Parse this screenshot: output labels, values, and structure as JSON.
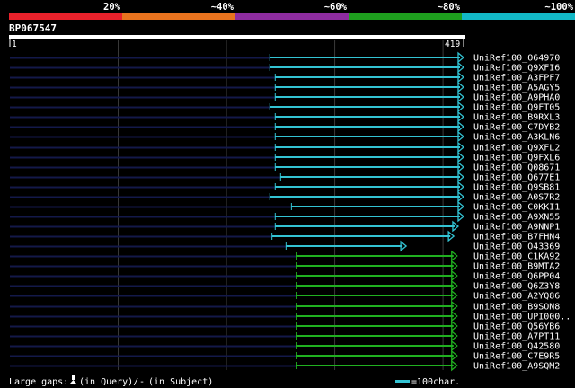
{
  "chart_data": {
    "type": "alignment_graphic",
    "query": {
      "name": "BP067547",
      "length": 419,
      "start_label": "1",
      "end_label": "419"
    },
    "identity_scale": [
      {
        "label": "20%",
        "color": "#e8212b"
      },
      {
        "label": "~40%",
        "color": "#e8731e"
      },
      {
        "label": "~60%",
        "color": "#8e2ca0"
      },
      {
        "label": "~80%",
        "color": "#1e9f1e"
      },
      {
        "label": "~100%",
        "color": "#12b8c6"
      }
    ],
    "hits": [
      {
        "name": "UniRef100_O64970",
        "q_start": 240,
        "q_end": 419,
        "color": "cyan",
        "arrow": "right"
      },
      {
        "name": "UniRef100_Q9XFI6",
        "q_start": 240,
        "q_end": 419,
        "color": "cyan",
        "arrow": "right"
      },
      {
        "name": "UniRef100_A3FPF7",
        "q_start": 245,
        "q_end": 419,
        "color": "cyan",
        "arrow": "right"
      },
      {
        "name": "UniRef100_A5AGY5",
        "q_start": 245,
        "q_end": 419,
        "color": "cyan",
        "arrow": "right"
      },
      {
        "name": "UniRef100_A9PHA0",
        "q_start": 245,
        "q_end": 419,
        "color": "cyan",
        "arrow": "right"
      },
      {
        "name": "UniRef100_Q9FT05",
        "q_start": 240,
        "q_end": 419,
        "color": "cyan",
        "arrow": "right"
      },
      {
        "name": "UniRef100_B9RXL3",
        "q_start": 245,
        "q_end": 419,
        "color": "cyan",
        "arrow": "right"
      },
      {
        "name": "UniRef100_C7DYB2",
        "q_start": 245,
        "q_end": 419,
        "color": "cyan",
        "arrow": "right"
      },
      {
        "name": "UniRef100_A3KLN6",
        "q_start": 245,
        "q_end": 419,
        "color": "cyan",
        "arrow": "right"
      },
      {
        "name": "UniRef100_Q9XFL2",
        "q_start": 245,
        "q_end": 419,
        "color": "cyan",
        "arrow": "right"
      },
      {
        "name": "UniRef100_Q9FXL6",
        "q_start": 245,
        "q_end": 419,
        "color": "cyan",
        "arrow": "right"
      },
      {
        "name": "UniRef100_Q08671",
        "q_start": 245,
        "q_end": 419,
        "color": "cyan",
        "arrow": "right"
      },
      {
        "name": "UniRef100_Q677E1",
        "q_start": 250,
        "q_end": 419,
        "color": "cyan",
        "arrow": "right"
      },
      {
        "name": "UniRef100_Q9SB81",
        "q_start": 245,
        "q_end": 419,
        "color": "cyan",
        "arrow": "right"
      },
      {
        "name": "UniRef100_A0S7R2",
        "q_start": 240,
        "q_end": 419,
        "color": "cyan",
        "arrow": "right"
      },
      {
        "name": "UniRef100_C0KKI1",
        "q_start": 260,
        "q_end": 419,
        "color": "cyan",
        "arrow": "right"
      },
      {
        "name": "UniRef100_A9XN55",
        "q_start": 245,
        "q_end": 419,
        "color": "cyan",
        "arrow": "right"
      },
      {
        "name": "UniRef100_A9NNP1",
        "q_start": 245,
        "q_end": 414,
        "color": "cyan",
        "arrow": "right"
      },
      {
        "name": "UniRef100_B7FHN4",
        "q_start": 242,
        "q_end": 410,
        "color": "cyan",
        "arrow": "right"
      },
      {
        "name": "UniRef100_O43369",
        "q_start": 255,
        "q_end": 366,
        "color": "cyan",
        "arrow": "right"
      },
      {
        "name": "UniRef100_C1KA92",
        "q_start": 265,
        "q_end": 413,
        "color": "green",
        "arrow": "right"
      },
      {
        "name": "UniRef100_B9MTA2",
        "q_start": 265,
        "q_end": 413,
        "color": "green",
        "arrow": "right"
      },
      {
        "name": "UniRef100_Q6PP04",
        "q_start": 265,
        "q_end": 413,
        "color": "green",
        "arrow": "right"
      },
      {
        "name": "UniRef100_Q6Z3Y8",
        "q_start": 265,
        "q_end": 413,
        "color": "green",
        "arrow": "right"
      },
      {
        "name": "UniRef100_A2YQ86",
        "q_start": 265,
        "q_end": 413,
        "color": "green",
        "arrow": "right"
      },
      {
        "name": "UniRef100_B9SON8",
        "q_start": 265,
        "q_end": 413,
        "color": "green",
        "arrow": "right"
      },
      {
        "name": "UniRef100_UPI000..",
        "q_start": 265,
        "q_end": 413,
        "color": "green",
        "arrow": "right"
      },
      {
        "name": "UniRef100_Q56YB6",
        "q_start": 265,
        "q_end": 413,
        "color": "green",
        "arrow": "right"
      },
      {
        "name": "UniRef100_A7PT11",
        "q_start": 265,
        "q_end": 413,
        "color": "green",
        "arrow": "right"
      },
      {
        "name": "UniRef100_Q42580",
        "q_start": 265,
        "q_end": 413,
        "color": "green",
        "arrow": "right"
      },
      {
        "name": "UniRef100_C7E9R5",
        "q_start": 265,
        "q_end": 413,
        "color": "green",
        "arrow": "right"
      },
      {
        "name": "UniRef100_A9SQM2",
        "q_start": 265,
        "q_end": 413,
        "color": "green",
        "arrow": "right"
      }
    ],
    "colors": {
      "cyan": "#33c3d3",
      "green": "#20b020",
      "navy": "#13194a"
    }
  },
  "footer": {
    "large_gaps_label": "Large gaps:",
    "in_query_label": "(in Query)/",
    "gap_dash": "-",
    "in_subject_label": "(in Subject)",
    "scale_label": "=100char."
  }
}
